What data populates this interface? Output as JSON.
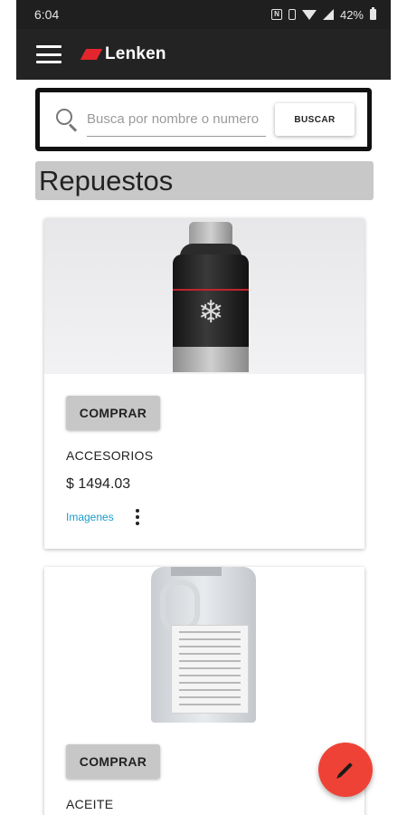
{
  "status_bar": {
    "time": "6:04",
    "battery": "42%",
    "icons": [
      "nfc-icon",
      "vibrate-icon",
      "wifi-icon",
      "signal-icon",
      "battery-icon"
    ]
  },
  "app_bar": {
    "menu_icon": "hamburger-menu-icon",
    "brand": "Lenken",
    "brand_color": "#e3262d"
  },
  "search": {
    "placeholder": "Busca por nombre o numero",
    "button_label": "BUSCAR",
    "icon": "search-icon"
  },
  "section": {
    "title": "Repuestos"
  },
  "products": [
    {
      "image": "antifreeze-bottle-image",
      "buy_label": "COMPRAR",
      "category": "ACCESORIOS",
      "price": "$ 1494.03",
      "images_link": "Imagenes",
      "more_icon": "more-vert-icon"
    },
    {
      "image": "oil-jug-image",
      "buy_label": "COMPRAR",
      "category": "ACEITE"
    }
  ],
  "fab": {
    "icon": "edit-pencil-icon",
    "color": "#ef4236"
  }
}
